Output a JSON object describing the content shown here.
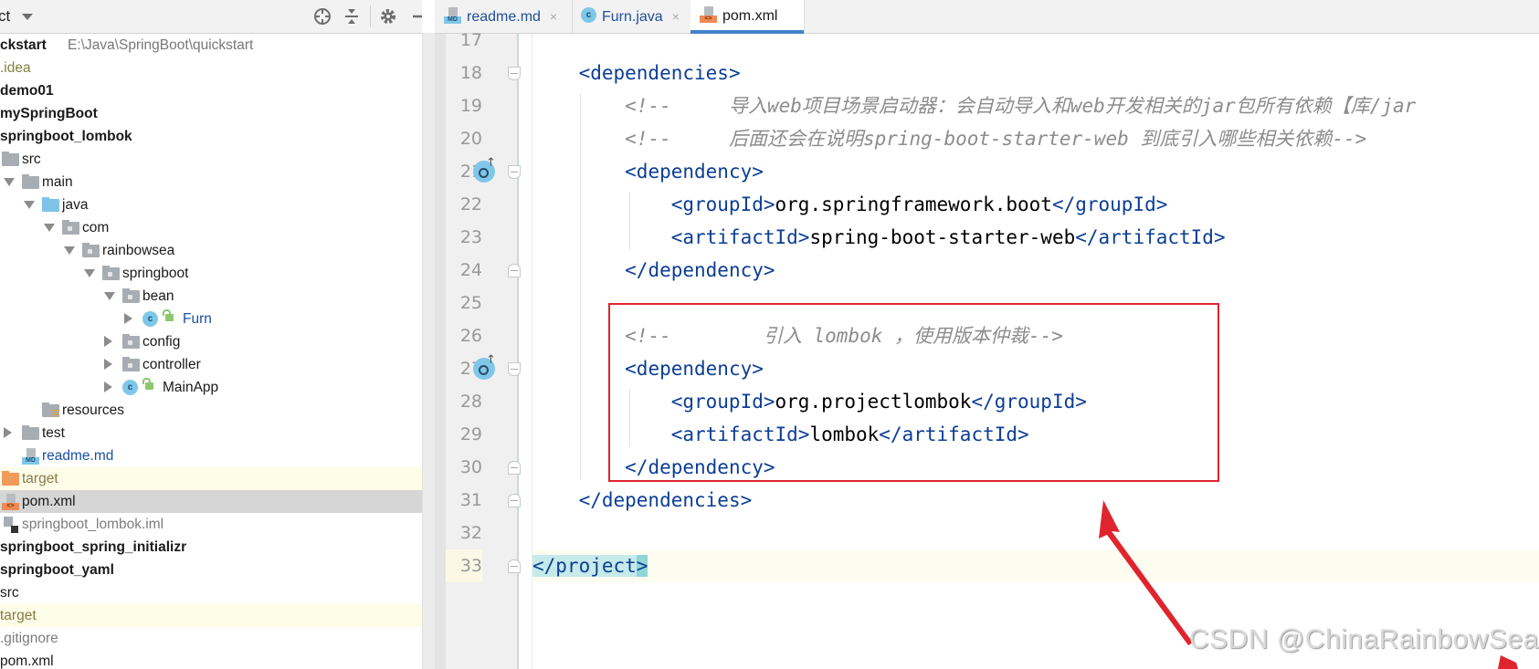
{
  "project_panel": {
    "title": "ct",
    "toolbar_icons": [
      "locate-icon",
      "collapse-all-icon",
      "settings-icon",
      "hide-icon"
    ],
    "tree": [
      {
        "label": "ckstart",
        "extra": "E:\\Java\\SpringBoot\\quickstart",
        "style": "bold",
        "depth": 0
      },
      {
        "label": ".idea",
        "style": "muted",
        "depth": 0
      },
      {
        "label": "demo01",
        "style": "bold",
        "depth": 0
      },
      {
        "label": "mySpringBoot",
        "style": "bold",
        "depth": 0
      },
      {
        "label": "springboot_lombok",
        "style": "bold",
        "depth": 0
      },
      {
        "label": "src",
        "icon": "folder",
        "depth": 1
      },
      {
        "label": "main",
        "icon": "folder",
        "arrow": "down",
        "depth": 2
      },
      {
        "label": "java",
        "icon": "source-folder",
        "arrow": "down",
        "depth": 3
      },
      {
        "label": "com",
        "icon": "package",
        "arrow": "down",
        "depth": 4
      },
      {
        "label": "rainbowsea",
        "icon": "package",
        "arrow": "down",
        "depth": 5
      },
      {
        "label": "springboot",
        "icon": "package",
        "arrow": "down",
        "depth": 6
      },
      {
        "label": "bean",
        "icon": "package",
        "arrow": "down",
        "depth": 7
      },
      {
        "label": "Furn",
        "icon": "class",
        "arrow": "right",
        "depth": 8,
        "style": "blue"
      },
      {
        "label": "config",
        "icon": "package",
        "arrow": "right",
        "depth": 7
      },
      {
        "label": "controller",
        "icon": "package",
        "arrow": "right",
        "depth": 7
      },
      {
        "label": "MainApp",
        "icon": "spring-class",
        "arrow": "right",
        "depth": 7
      },
      {
        "label": "resources",
        "icon": "resources-folder",
        "depth": 3
      },
      {
        "label": "test",
        "icon": "folder",
        "arrow": "right",
        "depth": 2
      },
      {
        "label": "readme.md",
        "icon": "markdown-file",
        "depth": 2,
        "style": "blue"
      },
      {
        "label": "target",
        "icon": "excluded-folder",
        "depth": 1,
        "style": "excluded"
      },
      {
        "label": "pom.xml",
        "icon": "xml-file",
        "depth": 1,
        "style": "selected"
      },
      {
        "label": "springboot_lombok.iml",
        "icon": "iml-file",
        "depth": 1,
        "style": "gray"
      },
      {
        "label": "springboot_spring_initializr",
        "style": "bold",
        "depth": 0
      },
      {
        "label": "springboot_yaml",
        "style": "bold",
        "depth": 0
      },
      {
        "label": "src",
        "depth": 0
      },
      {
        "label": "target",
        "depth": 0,
        "style": "excluded"
      },
      {
        "label": ".gitignore",
        "depth": 0,
        "style": "gray"
      },
      {
        "label": "pom.xml",
        "depth": 0
      }
    ]
  },
  "editor": {
    "tabs": [
      {
        "label": "readme.md",
        "icon": "markdown-file",
        "close": "×",
        "active": false
      },
      {
        "label": "Furn.java",
        "icon": "class",
        "close": "×",
        "active": false
      },
      {
        "label": "pom.xml",
        "icon": "xml-file",
        "close": "",
        "active": true
      }
    ],
    "lines": [
      {
        "num": "17",
        "tokens": []
      },
      {
        "num": "18",
        "tokens": [
          {
            "t": "    ",
            "c": ""
          },
          {
            "t": "<dependencies>",
            "c": "tag"
          }
        ]
      },
      {
        "num": "19",
        "tokens": [
          {
            "t": "        ",
            "c": ""
          },
          {
            "t": "<!--     导入web项目场景启动器：会自动导入和web开发相关的jar包所有依赖【库/jar",
            "c": "cm"
          }
        ]
      },
      {
        "num": "20",
        "tokens": [
          {
            "t": "        ",
            "c": ""
          },
          {
            "t": "<!--     后面还会在说明spring-boot-starter-web 到底引入哪些相关依赖-->",
            "c": "cm"
          }
        ]
      },
      {
        "num": "21",
        "tokens": [
          {
            "t": "        ",
            "c": ""
          },
          {
            "t": "<dependency>",
            "c": "tag"
          }
        ]
      },
      {
        "num": "22",
        "tokens": [
          {
            "t": "            ",
            "c": ""
          },
          {
            "t": "<groupId>",
            "c": "tag"
          },
          {
            "t": "org.springframework.boot",
            "c": ""
          },
          {
            "t": "</groupId>",
            "c": "tag"
          }
        ]
      },
      {
        "num": "23",
        "tokens": [
          {
            "t": "            ",
            "c": ""
          },
          {
            "t": "<artifactId>",
            "c": "tag"
          },
          {
            "t": "spring-boot-starter-web",
            "c": ""
          },
          {
            "t": "</artifactId>",
            "c": "tag"
          }
        ]
      },
      {
        "num": "24",
        "tokens": [
          {
            "t": "        ",
            "c": ""
          },
          {
            "t": "</dependency>",
            "c": "tag"
          }
        ]
      },
      {
        "num": "25",
        "tokens": []
      },
      {
        "num": "26",
        "tokens": [
          {
            "t": "        ",
            "c": ""
          },
          {
            "t": "<!--        引入 lombok ，使用版本仲裁-->",
            "c": "cm"
          }
        ]
      },
      {
        "num": "27",
        "tokens": [
          {
            "t": "        ",
            "c": ""
          },
          {
            "t": "<dependency>",
            "c": "tag"
          }
        ]
      },
      {
        "num": "28",
        "tokens": [
          {
            "t": "            ",
            "c": ""
          },
          {
            "t": "<groupId>",
            "c": "tag"
          },
          {
            "t": "org.projectlombok",
            "c": ""
          },
          {
            "t": "</groupId>",
            "c": "tag"
          }
        ]
      },
      {
        "num": "29",
        "tokens": [
          {
            "t": "            ",
            "c": ""
          },
          {
            "t": "<artifactId>",
            "c": "tag"
          },
          {
            "t": "lombok",
            "c": ""
          },
          {
            "t": "</artifactId>",
            "c": "tag"
          }
        ]
      },
      {
        "num": "30",
        "tokens": [
          {
            "t": "        ",
            "c": ""
          },
          {
            "t": "</dependency>",
            "c": "tag"
          }
        ]
      },
      {
        "num": "31",
        "tokens": [
          {
            "t": "    ",
            "c": ""
          },
          {
            "t": "</dependencies>",
            "c": "tag"
          }
        ]
      },
      {
        "num": "32",
        "tokens": []
      },
      {
        "num": "33",
        "tokens": [
          {
            "t": "</project",
            "c": "tag hl"
          },
          {
            "t": ">",
            "c": "tag hl-end"
          }
        ]
      }
    ],
    "caret_line": "33",
    "gutter_badges": [
      "21",
      "27"
    ]
  },
  "annotation": {
    "box_color": "#e0242e",
    "arrow_color": "#e0242e",
    "watermark": "CSDN @ChinaRainbowSea"
  }
}
